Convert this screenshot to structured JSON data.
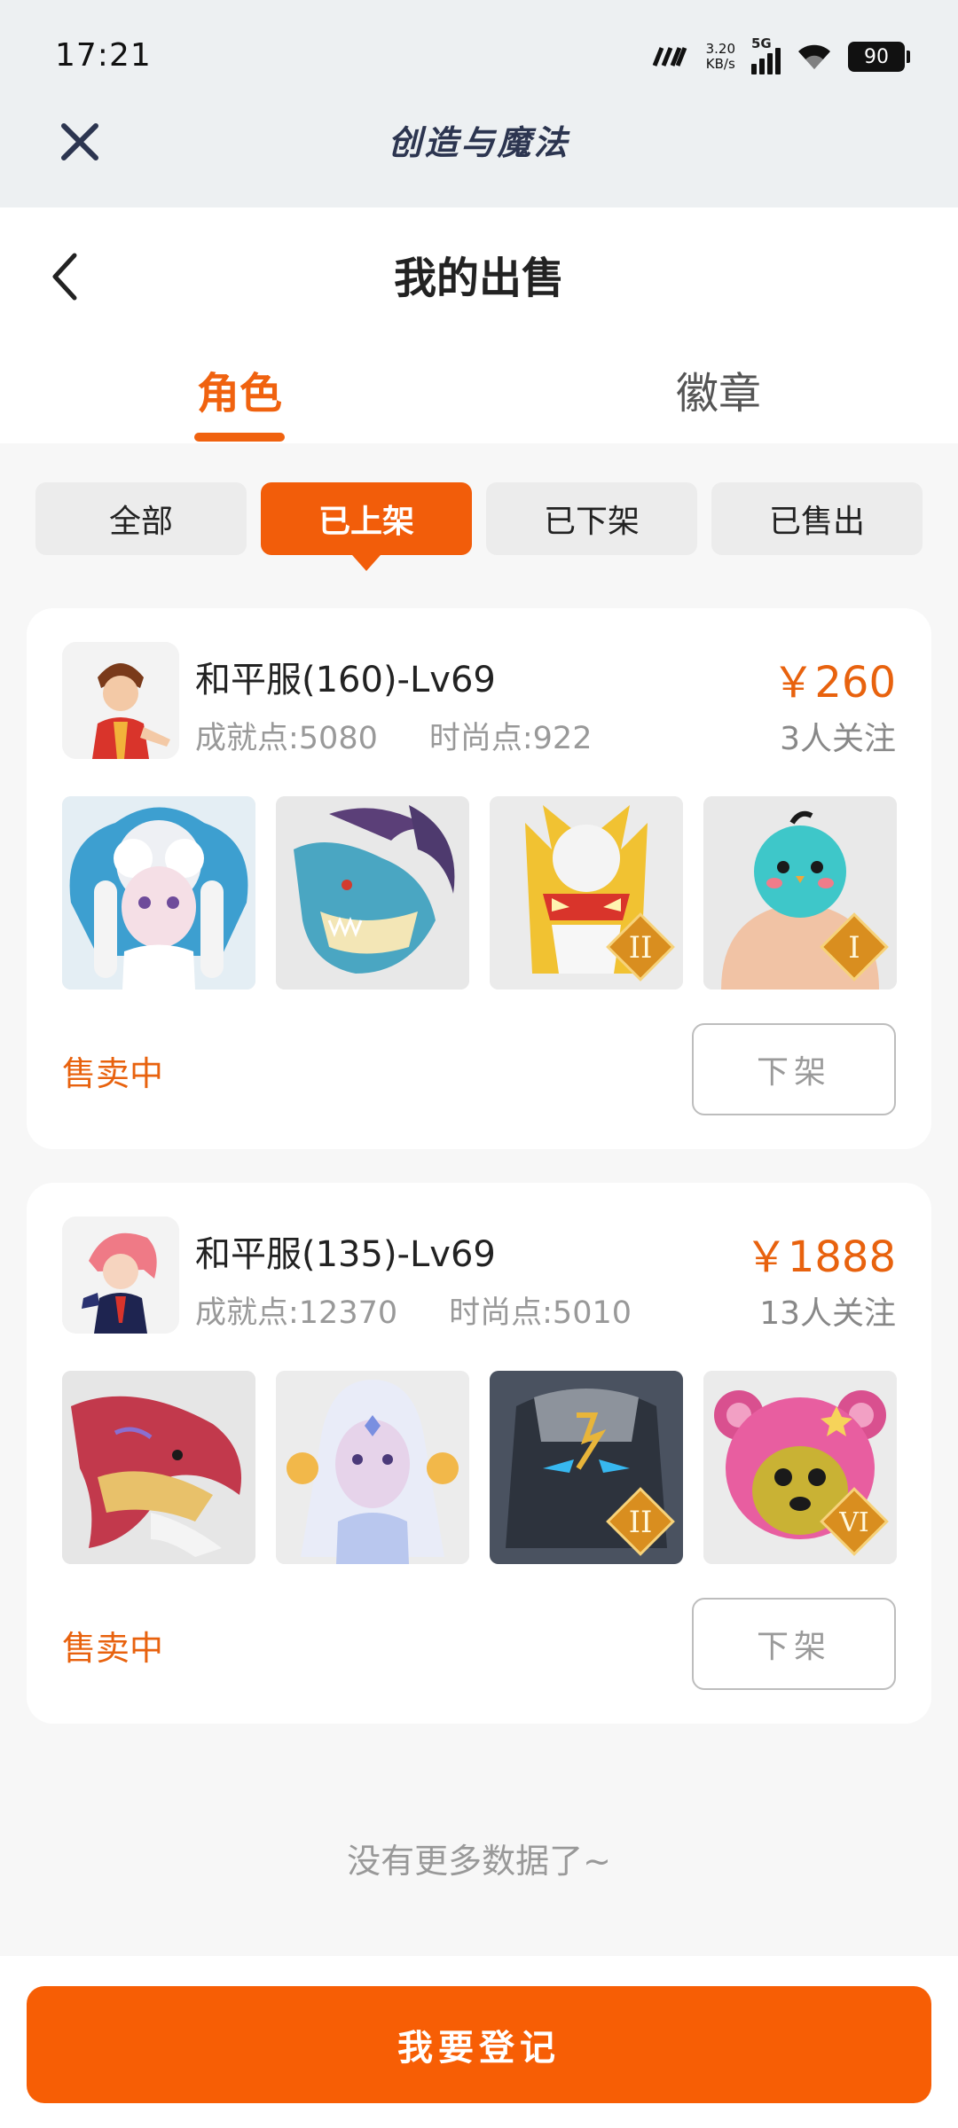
{
  "status_bar": {
    "time": "17:21",
    "speed_value": "3.20",
    "speed_unit": "KB/s",
    "network": "5G",
    "battery": "90"
  },
  "top_bar": {
    "title": "创造与魔法"
  },
  "page": {
    "title": "我的出售"
  },
  "tabs": [
    {
      "label": "角色",
      "active": true
    },
    {
      "label": "徽章",
      "active": false
    }
  ],
  "filters": [
    {
      "label": "全部",
      "active": false
    },
    {
      "label": "已上架",
      "active": true
    },
    {
      "label": "已下架",
      "active": false
    },
    {
      "label": "已售出",
      "active": false
    }
  ],
  "listings": [
    {
      "name": "和平服(160)-Lv69",
      "achievement": "成就点:5080",
      "fashion": "时尚点:922",
      "price": "￥260",
      "followers": "3人关注",
      "status": "售卖中",
      "action": "下架",
      "pets": [
        {
          "icon": "white-fluffy-pet-icon",
          "rank": ""
        },
        {
          "icon": "blue-dragon-pet-icon",
          "rank": ""
        },
        {
          "icon": "golden-armor-pet-icon",
          "rank": "II"
        },
        {
          "icon": "blue-bird-pet-icon",
          "rank": "I"
        }
      ]
    },
    {
      "name": "和平服(135)-Lv69",
      "achievement": "成就点:12370",
      "fashion": "时尚点:5010",
      "price": "￥1888",
      "followers": "13人关注",
      "status": "售卖中",
      "action": "下架",
      "pets": [
        {
          "icon": "red-dragon-pet-icon",
          "rank": ""
        },
        {
          "icon": "white-spirit-pet-icon",
          "rank": ""
        },
        {
          "icon": "dark-golem-pet-icon",
          "rank": "II"
        },
        {
          "icon": "pink-bear-pet-icon",
          "rank": "VI"
        }
      ]
    }
  ],
  "footer": {
    "no_more": "没有更多数据了~",
    "register_button": "我要登记"
  },
  "colors": {
    "accent": "#f25d0a",
    "price": "#e8620e",
    "background": "#f7f7f7"
  }
}
